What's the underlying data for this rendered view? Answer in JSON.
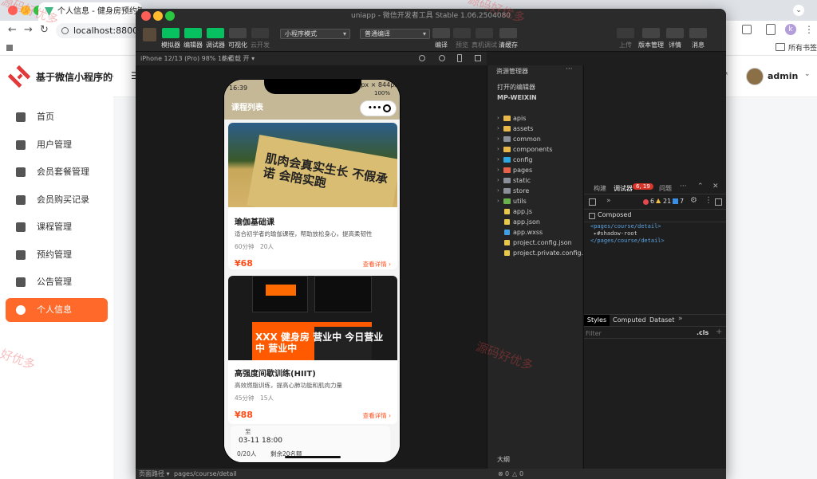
{
  "browser": {
    "tab_title": "个人信息 - 健身房预约管理系统",
    "url": "localhost:8800/bac",
    "bookmarks_label": "所有书签",
    "profile_letter": "k"
  },
  "admin": {
    "logo_text": "基于微信小程序的健",
    "user_name": "admin",
    "menu": [
      {
        "label": "首页",
        "icon": "home-icon"
      },
      {
        "label": "用户管理",
        "icon": "user-icon"
      },
      {
        "label": "会员套餐管理",
        "icon": "crown-icon"
      },
      {
        "label": "会员购买记录",
        "icon": "document-icon"
      },
      {
        "label": "课程管理",
        "icon": "book-icon"
      },
      {
        "label": "预约管理",
        "icon": "calendar-check-icon"
      },
      {
        "label": "公告管理",
        "icon": "megaphone-icon"
      },
      {
        "label": "个人信息",
        "icon": "person-icon",
        "active": true
      }
    ]
  },
  "devtools": {
    "title": "uniapp - 微信开发者工具 Stable 1.06.2504080",
    "toolbar": {
      "simulator": "模拟器",
      "editor": "编辑器",
      "debugger": "调试器",
      "visual": "可视化",
      "cloud": "云开发",
      "mode_select": "小程序模式",
      "compile_select": "普通编译",
      "compile": "编译",
      "preview": "预览",
      "real_debug": "真机调试",
      "clear_cache": "清缓存",
      "upload": "上传",
      "version": "版本管理",
      "details": "详情",
      "messages": "消息"
    },
    "device": "iPhone 12/13 (Pro) 98% 16 ▾",
    "hot_reload": "热重载 开 ▾",
    "phone": {
      "time": "16:39",
      "size_label": "390px × 844px",
      "battery": "100%",
      "nav_title": "课程列表",
      "courses": [
        {
          "title": "瑜伽基础课",
          "desc": "适合初学者的瑜伽课程，帮助放松身心，提高柔韧性",
          "duration": "60分钟",
          "capacity": "20人",
          "price": "¥68",
          "link": "查看详情 ›",
          "banner": "肌肉会真实生长 不假承诺 会陪实跑"
        },
        {
          "title": "高强度间歇训练(HIIT)",
          "desc": "高效燃脂训练，提高心肺功能和肌肉力量",
          "duration": "45分钟",
          "capacity": "15人",
          "price": "¥88",
          "link": "查看详情 ›",
          "banner": "XXX 健身房 营业中 今日营业中 营业中"
        }
      ],
      "peek": {
        "to": "至",
        "time": "03-11 18:00",
        "count": "0/20人",
        "remaining": "剩余20名额"
      }
    },
    "explorer": {
      "title": "资源管理器",
      "open_editors": "打开的编辑器",
      "project": "MP-WEIXIN",
      "items": [
        {
          "name": "apis",
          "type": "folder",
          "color": "#e8b84a"
        },
        {
          "name": "assets",
          "type": "folder",
          "color": "#e8b84a"
        },
        {
          "name": "common",
          "type": "folder",
          "color": "#8a8f99"
        },
        {
          "name": "components",
          "type": "folder",
          "color": "#e8b84a"
        },
        {
          "name": "config",
          "type": "folder",
          "color": "#2fa7e0"
        },
        {
          "name": "pages",
          "type": "folder",
          "color": "#e8614a"
        },
        {
          "name": "static",
          "type": "folder",
          "color": "#8a8f99"
        },
        {
          "name": "store",
          "type": "folder",
          "color": "#8a8f99"
        },
        {
          "name": "utils",
          "type": "folder",
          "color": "#6ab04c"
        },
        {
          "name": "app.js",
          "type": "js",
          "color": "#e8c84a"
        },
        {
          "name": "app.json",
          "type": "json",
          "color": "#e8c84a"
        },
        {
          "name": "app.wxss",
          "type": "wxss",
          "color": "#3fa0e8"
        },
        {
          "name": "project.config.json",
          "type": "json",
          "color": "#e8c84a"
        },
        {
          "name": "project.private.config.json",
          "type": "json",
          "color": "#e8c84a"
        }
      ],
      "outline": "大纲"
    },
    "debug": {
      "tabs": [
        "构建",
        "调试器",
        "问题"
      ],
      "badge": "6, 19",
      "errors": "6",
      "warnings": "21",
      "infos": "7",
      "composed": "Composed",
      "dom": [
        "<pages/course/detail>",
        "▸#shadow-root",
        "</pages/course/detail>"
      ],
      "style_tabs": [
        "Styles",
        "Computed",
        "Dataset"
      ],
      "filter_placeholder": "Filter",
      "cls": ".cls"
    },
    "status": {
      "page_path_label": "页面路径 ▾",
      "page_path": "pages/course/detail",
      "err_count": "0",
      "warn_count": "0"
    }
  },
  "watermarks": [
    "源码好优多",
    "源码好优多",
    "好优多",
    "源码好优多"
  ]
}
